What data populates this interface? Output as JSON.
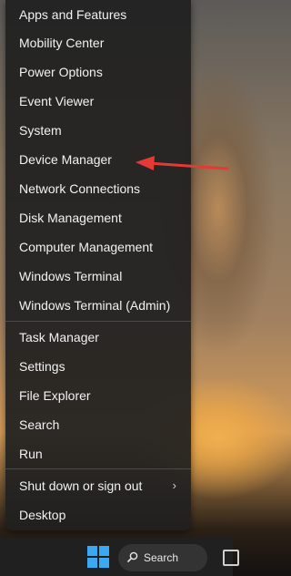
{
  "menu": {
    "items": [
      {
        "label": "Apps and Features"
      },
      {
        "label": "Mobility Center"
      },
      {
        "label": "Power Options"
      },
      {
        "label": "Event Viewer"
      },
      {
        "label": "System"
      },
      {
        "label": "Device Manager"
      },
      {
        "label": "Network Connections"
      },
      {
        "label": "Disk Management"
      },
      {
        "label": "Computer Management"
      },
      {
        "label": "Windows Terminal"
      },
      {
        "label": "Windows Terminal (Admin)"
      },
      {
        "label": "Task Manager"
      },
      {
        "label": "Settings"
      },
      {
        "label": "File Explorer"
      },
      {
        "label": "Search"
      },
      {
        "label": "Run"
      },
      {
        "label": "Shut down or sign out"
      },
      {
        "label": "Desktop"
      }
    ]
  },
  "annotation": {
    "arrow_color": "#e53935"
  },
  "taskbar": {
    "search_label": "Search",
    "start_icon": "windows-logo-icon",
    "accent": "#39a9f4"
  }
}
